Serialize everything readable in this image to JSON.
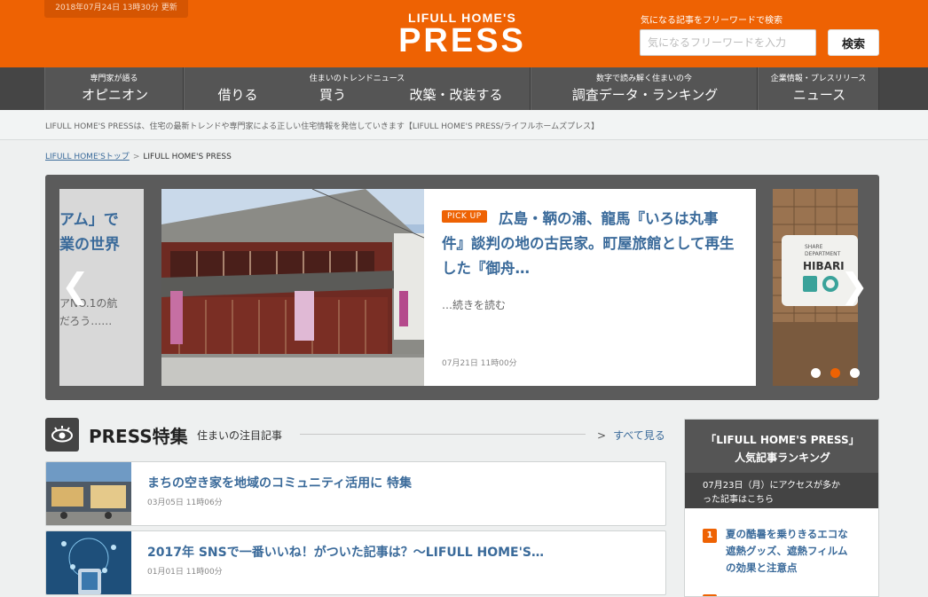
{
  "header": {
    "updated": "2018年07月24日 13時30分 更新",
    "logo_top": "LIFULL HOME'S",
    "logo_main": "PRESS",
    "search_caption": "気になる記事をフリーワードで検索",
    "search_placeholder": "気になるフリーワードを入力",
    "search_button": "検索"
  },
  "nav": {
    "groups": [
      {
        "caption": "専門家が語る",
        "items": [
          "オピニオン"
        ]
      },
      {
        "caption": "住まいのトレンドニュース",
        "items": [
          "借りる",
          "買う",
          "改築・改装する"
        ]
      },
      {
        "caption": "数字で読み解く住まいの今",
        "items": [
          "調査データ・ランキング"
        ]
      },
      {
        "caption": "企業情報・プレスリリース",
        "items": [
          "ニュース"
        ]
      }
    ]
  },
  "tagline": "LIFULL HOME'S PRESSは、住宅の最新トレンドや専門家による正しい住宅情報を発信していきます【LIFULL HOME'S PRESS/ライフルホームズプレス】",
  "breadcrumb": {
    "home": "LIFULL HOME'Sトップ",
    "current": "LIFULL HOME'S PRESS"
  },
  "carousel": {
    "prev_slide": {
      "title_line1": "アム」で",
      "title_line2": "業の世界",
      "excerpt_line1": "アNO.1の航",
      "excerpt_line2": "だろう……"
    },
    "current": {
      "badge": "PICK UP",
      "title": "広島・鞆の浦、龍馬『いろは丸事件』談判の地の古民家。町屋旅館として再生した『御舟…",
      "read_more": "…続きを読む",
      "date": "07月21日 11時00分"
    },
    "next_slide": {
      "sign_line1": "SHARE",
      "sign_line2": "DEPARTMENT",
      "sign_line3": "HIBARI"
    },
    "prev_icon": "chevron-left-icon",
    "next_icon": "chevron-right-icon",
    "active_dot": 1,
    "dot_count": 3
  },
  "feature": {
    "icon": "eye-icon",
    "title": "PRESS特集",
    "subtitle": "住まいの注目記事",
    "see_all": "すべて見る",
    "articles": [
      {
        "title": "まちの空き家を地域のコミュニティ活用に 特集",
        "date": "03月05日 11時06分"
      },
      {
        "title": "2017年 SNSで一番いいね！がついた記事は？～LIFULL HOME'S…",
        "date": "01月01日 11時00分"
      }
    ]
  },
  "ranking": {
    "title_line1": "「LIFULL HOME'S PRESS」",
    "title_line2": "人気記事ランキング",
    "desc_line1": "07月23日（月）にアクセスが多か",
    "desc_line2": "った記事はこちら",
    "items": [
      {
        "rank": "1",
        "line1": "夏の酷暑を乗りきるエコな",
        "line2": "遮熱グッズ、遮熱フィルム",
        "line3": "の効果と注意点"
      }
    ]
  },
  "colors": {
    "brand": "#ee6203",
    "nav": "#555555",
    "link": "#3a6a9a"
  }
}
